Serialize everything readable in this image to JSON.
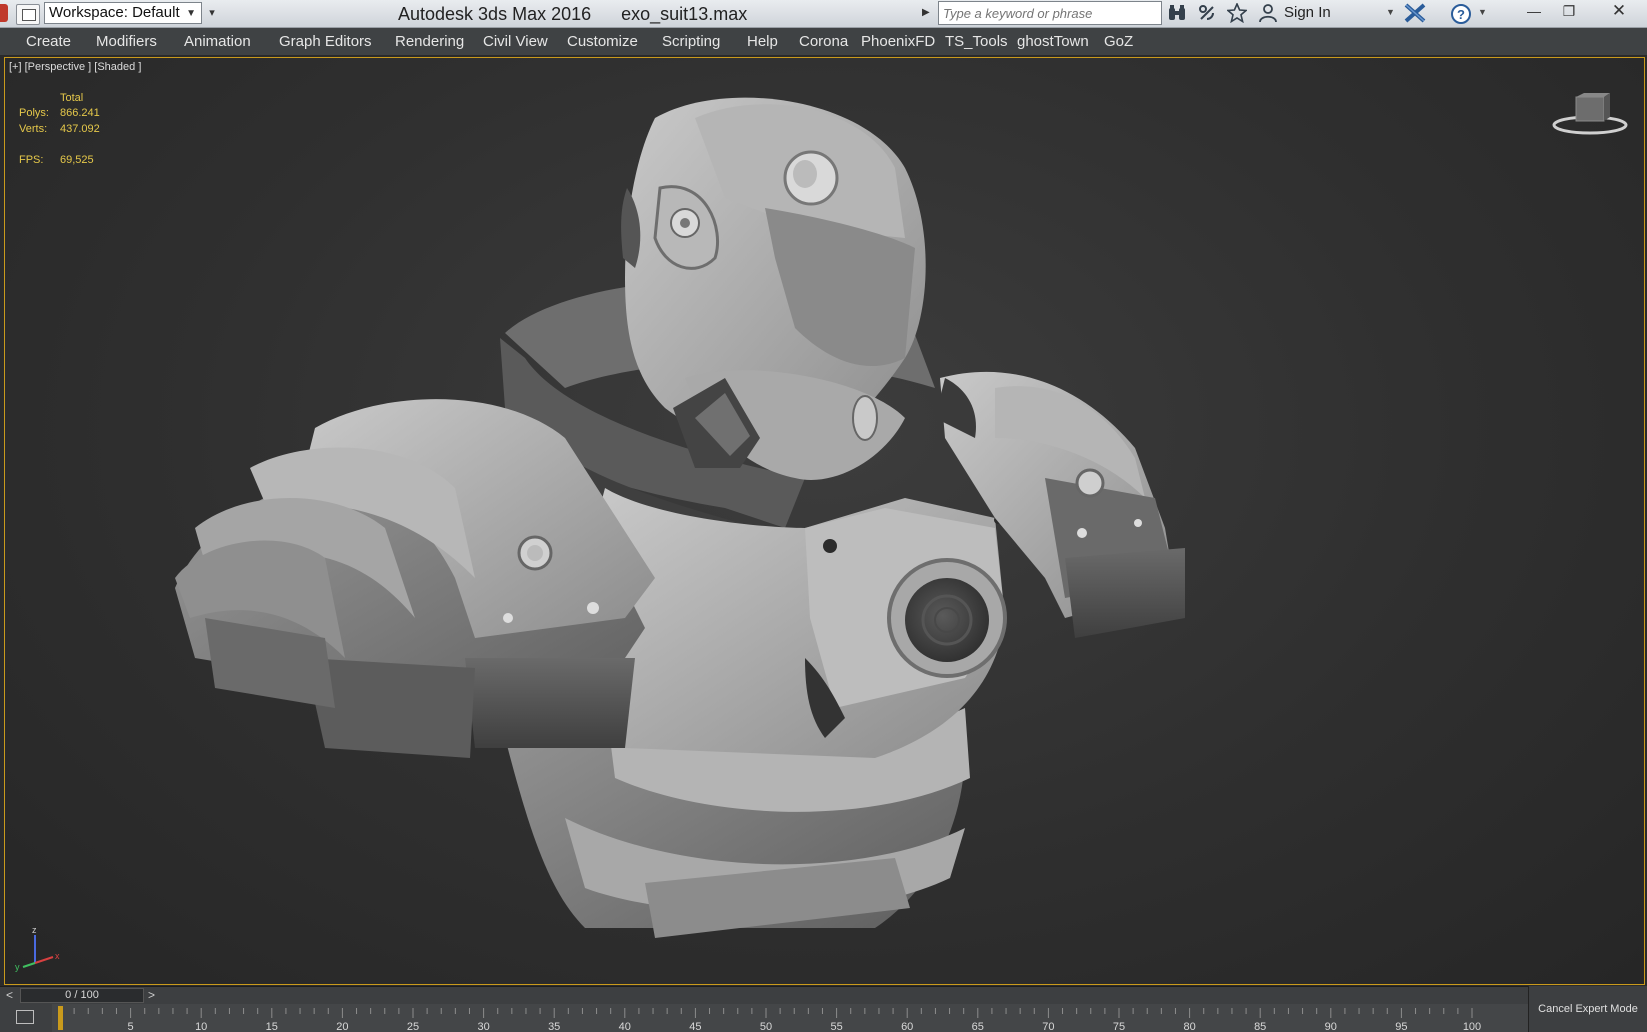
{
  "titlebar": {
    "workspace_label": "Workspace: Default",
    "app_name": "Autodesk 3ds Max 2016",
    "file_name": "exo_suit13.max",
    "search_placeholder": "Type a keyword or phrase",
    "sign_in": "Sign In",
    "icons": [
      "binoculars-icon",
      "satellite-icon",
      "star-icon",
      "user-icon",
      "x-logo-icon",
      "help-icon"
    ]
  },
  "menu": {
    "items": [
      "Create",
      "Modifiers",
      "Animation",
      "Graph Editors",
      "Rendering",
      "Civil View",
      "Customize",
      "Scripting",
      "Help",
      "Corona",
      "PhoenixFD",
      "TS_Tools",
      "ghostTown",
      "GoZ"
    ]
  },
  "viewport": {
    "label": "[+] [Perspective ] [Shaded ]",
    "stats": {
      "header": "Total",
      "polys_label": "Polys:",
      "polys_value": "866.241",
      "verts_label": "Verts:",
      "verts_value": "437.092",
      "fps_label": "FPS:",
      "fps_value": "69,525"
    }
  },
  "timeline": {
    "prev": "<",
    "frame_display": "0 / 100",
    "next": ">",
    "ticks": [
      "5",
      "10",
      "15",
      "20",
      "25",
      "30",
      "35",
      "40",
      "45",
      "50",
      "55",
      "60",
      "65",
      "70",
      "75",
      "80",
      "85",
      "90",
      "95",
      "100"
    ],
    "current_frame": 0,
    "total_frames": 100
  },
  "status": {
    "cancel_expert": "Cancel Expert Mode"
  },
  "colors": {
    "accent": "#c99a1c",
    "stat_text": "#e5c84a",
    "menubar": "#3f4244"
  }
}
